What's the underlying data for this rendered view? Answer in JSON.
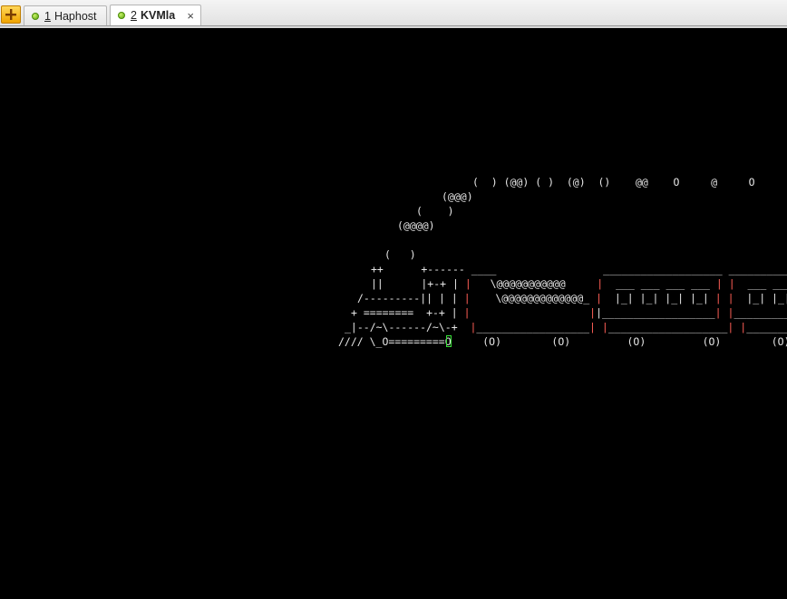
{
  "tabbar": {
    "new_tab_icon": "orange-plus-folder-icon",
    "tabs": [
      {
        "num": "1",
        "label": "Haphost",
        "active": false,
        "status_color": "#6cc417"
      },
      {
        "num": "2",
        "label": "KVMla",
        "active": true,
        "status_color": "#6cc417",
        "close": "×"
      }
    ]
  },
  "terminal": {
    "background": "#000000",
    "ascii_color": "#e6e6e6",
    "accent_color": "#ff5f56",
    "cursor_color": "#38e038",
    "sl_train": {
      "smoke1": "(  ) (@@) ( )  (@)  ()    @@    O     @     O",
      "smoke2": "(@@@)",
      "smoke3": "(    )",
      "smoke4": "(@@@@)",
      "smoke5": "(   )",
      "r1_engine": "++      +------ ",
      "r1_cars": "____                 ___________________ ______________",
      "r2_engine": "||      |+-+ | ",
      "r2_bar1": "|",
      "r2_mid": "   \\@@@@@@@@@@@     ",
      "r2_bar2": "|",
      "r2_c1": "  ___ ___ ___ ___ ",
      "r2_bar3": "|",
      "r2_c2": " ",
      "r2_bar4": "|",
      "r2_c3": "  ___ ___",
      "r3_engine": "/---------|| | | ",
      "r3_bar1": "|",
      "r3_mid": "    \\@@@@@@@@@@@@@_ ",
      "r3_bar2": "|",
      "r3_c1": "  |_| |_| |_| |_| ",
      "r3_bar3": "|",
      "r3_c2": " ",
      "r3_bar4": "|",
      "r3_c3": "  |_| |_|",
      "r4_engine": "+ ========  +-+ | ",
      "r4_bar1": "|",
      "r4_mid": "                   ",
      "r4_bar2": "|",
      "r4_c1": "|__________________",
      "r4_bar3": "|",
      "r4_c2": " ",
      "r4_bar4": "|",
      "r4_c3": "_________",
      "r5_engine": "_|--/~\\------/~\\-+  ",
      "r5_bar1": "|",
      "r5_mid": "__________________",
      "r5_bar2": "|",
      "r5_gap": " ",
      "r5_bar3": "|",
      "r5_c1": "___________________",
      "r5_bar4": "|",
      "r5_c2": " ",
      "r5_bar5": "|",
      "r5_c3": "_________",
      "r6": "//// \\_O=========O     (O)        (O)         (O)         (O)        (O)"
    }
  }
}
